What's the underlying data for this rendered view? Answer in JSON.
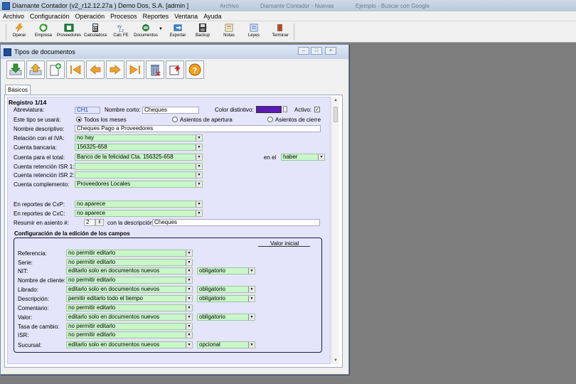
{
  "app": {
    "title": "Diamante Contador (v2_r12.12.27a ) Demo Dos, S.A.  [admin ]",
    "ghost_tabs": [
      "Archivo",
      "Diamante Contador - Nuevas",
      "Ejemplo - Buscar con Google"
    ]
  },
  "menu": [
    "Archivo",
    "Configuración",
    "Operación",
    "Procesos",
    "Reportes",
    "Ventana",
    "Ayuda"
  ],
  "toolbar": [
    {
      "label": "Operar",
      "icon": "lightning-icon"
    },
    {
      "label": "Empresa",
      "icon": "recycle-icon"
    },
    {
      "label": "Proveedores",
      "icon": "supplier-icon"
    },
    {
      "label": "Calculadora",
      "icon": "calculator-icon"
    },
    {
      "label": "Calc FE",
      "icon": "calc-fe-icon"
    },
    {
      "label": "Documentos",
      "icon": "documents-icon"
    },
    {
      "label": "Exportar",
      "icon": "export-icon"
    },
    {
      "label": "Backup",
      "icon": "floppy-icon"
    },
    {
      "label": "Notas",
      "icon": "notes-icon"
    },
    {
      "label": "Leyes",
      "icon": "laws-icon"
    },
    {
      "label": "Terminar",
      "icon": "exit-icon"
    }
  ],
  "window": {
    "title": "Tipos de documentos",
    "tab": "Básicos"
  },
  "form": {
    "registro": "Registro 1/14",
    "abreviatura_label": "Abreviatura:",
    "abreviatura": "CH1",
    "nombre_corto_label": "Nombre corto:",
    "nombre_corto": "Cheques",
    "color_label": "Color distintivo:",
    "color": "#5a18b4",
    "activo_label": "Activo:",
    "activo": "✓",
    "este_tipo_label": "Este tipo se usará:",
    "radio_todos": "Todos los meses",
    "radio_apertura": "Asientos de apertura",
    "radio_cierre": "Asientos de cierre",
    "nombre_desc_label": "Nombre descriptivo:",
    "nombre_desc": "Cheques Pago a Proveedores",
    "relacion_iva_label": "Relación con el IVA:",
    "relacion_iva": "no hay",
    "cuenta_bancaria_label": "Cuenta bancaria:",
    "cuenta_bancaria": "156325-658",
    "cuenta_total_label": "Cuenta para el total:",
    "cuenta_total": "Banco de la felicidad Cta. 156325-658",
    "en_el_label": "en el",
    "en_el": "haber",
    "ret_isr1_label": "Cuenta retención ISR 1:",
    "ret_isr1": "",
    "ret_isr2_label": "Cuenta retención ISR 2:",
    "ret_isr2": "",
    "complemento_label": "Cuenta complemento:",
    "complemento": "Proveedores Locales",
    "cxp_label": "En reportes de CxP:",
    "cxp": "no aparece",
    "cxc_label": "En reportes de CxC:",
    "cxc": "no aparece",
    "resumir_label": "Resumir en asiento #:",
    "resumir": "2",
    "con_desc_label": "con la descripción",
    "con_desc": "Cheques"
  },
  "config": {
    "title": "Configuración de la edición de los campos",
    "valor_inicial": "Valor inicial",
    "rows": [
      {
        "label": "Referencia:",
        "value": "no permitir editarlo",
        "extra": ""
      },
      {
        "label": "Serie:",
        "value": "no permitir editarlo",
        "extra": ""
      },
      {
        "label": "NIT:",
        "value": "editarlo solo en documentos nuevos",
        "extra": "obligatorio"
      },
      {
        "label": "Nombre de cliente:",
        "value": "no permitir editarlo",
        "extra": ""
      },
      {
        "label": "Librado:",
        "value": "editarlo solo en documentos nuevos",
        "extra": "obligatorio"
      },
      {
        "label": "Descripción:",
        "value": "pemitir editarlo todo el tiempo",
        "extra": "obligatorio"
      },
      {
        "label": "Comentario:",
        "value": "no permitir editarlo",
        "extra": ""
      },
      {
        "label": "Valor:",
        "value": "editarlo solo en documentos nuevos",
        "extra": "obligatorio"
      },
      {
        "label": "Tasa de cambio:",
        "value": "no permitir editarlo",
        "extra": ""
      },
      {
        "label": "ISR:",
        "value": "no permitir editarlo",
        "extra": ""
      },
      {
        "label": "Sucursal:",
        "value": "editarlo solo en documentos nuevos",
        "extra": "opcional"
      }
    ]
  }
}
